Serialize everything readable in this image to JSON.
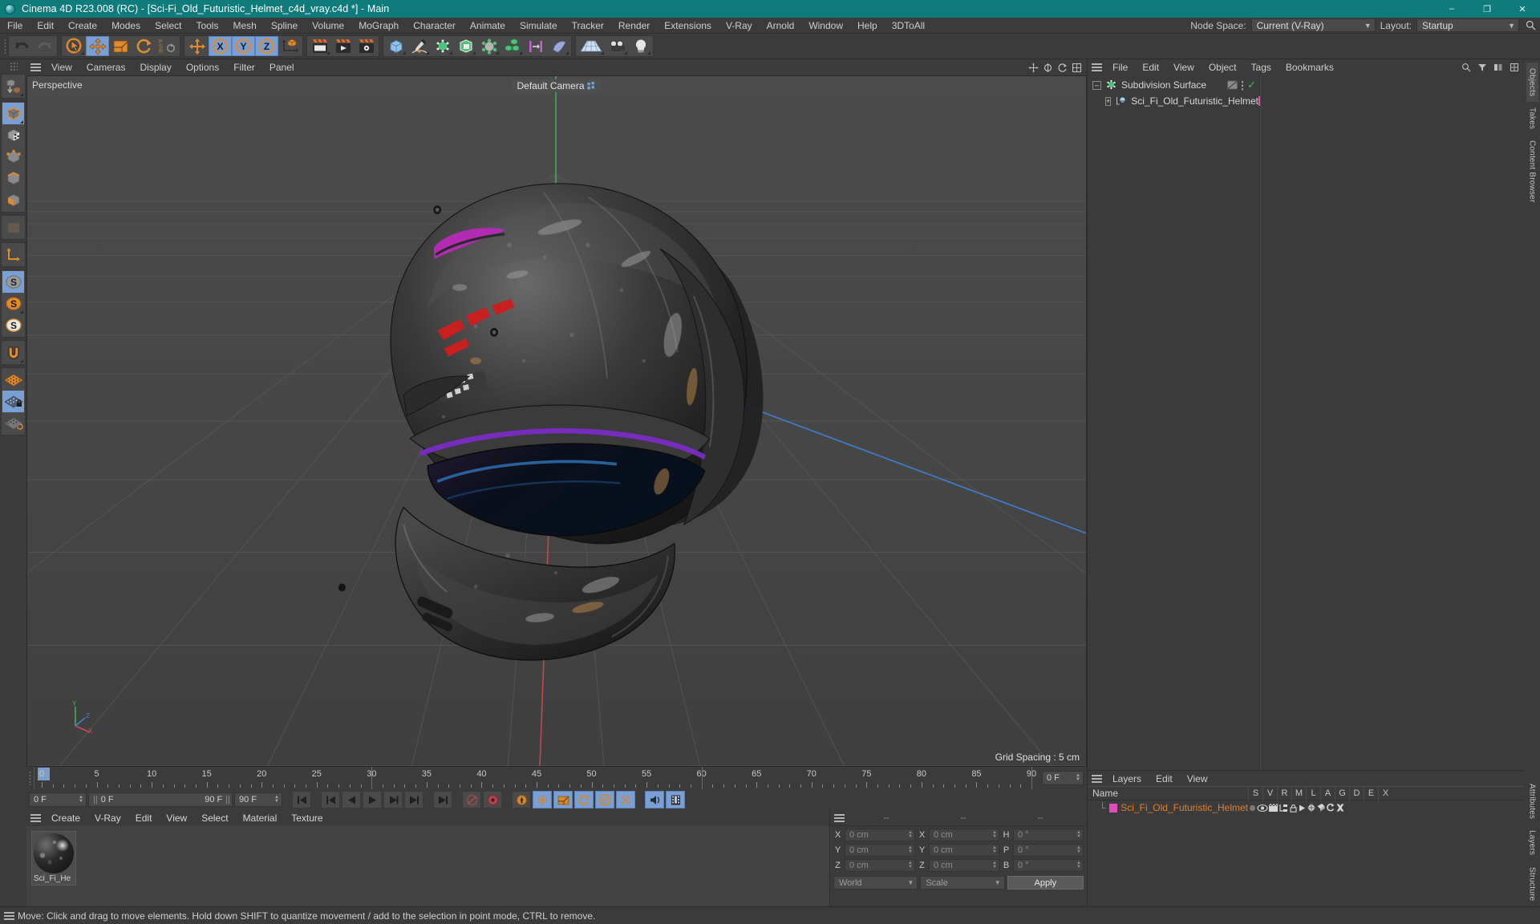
{
  "window": {
    "title": "Cinema 4D R23.008 (RC) - [Sci-Fi_Old_Futuristic_Helmet_c4d_vray.c4d *] - Main",
    "minimize": "–",
    "maximize": "❐",
    "close": "✕",
    "titlebar_color": "#0f7b7b"
  },
  "menubar": {
    "items": [
      "File",
      "Edit",
      "Create",
      "Modes",
      "Select",
      "Tools",
      "Mesh",
      "Spline",
      "Volume",
      "MoGraph",
      "Character",
      "Animate",
      "Simulate",
      "Tracker",
      "Render",
      "Extensions",
      "V-Ray",
      "Arnold",
      "Window",
      "Help",
      "3DToAll"
    ],
    "node_space_label": "Node Space:",
    "node_space_value": "Current (V-Ray)",
    "layout_label": "Layout:",
    "layout_value": "Startup",
    "search_icon": "search-icon"
  },
  "toolbar": {
    "groups": [
      {
        "name": "history",
        "buttons": [
          {
            "name": "undo",
            "icon": "undo-arrow-icon"
          },
          {
            "name": "redo",
            "icon": "redo-arrow-icon"
          }
        ]
      },
      {
        "name": "transform",
        "buttons": [
          {
            "name": "live-selection",
            "icon": "cursor-circle-icon",
            "sub": true
          },
          {
            "name": "move",
            "icon": "move-arrows-icon",
            "selected": true
          },
          {
            "name": "scale",
            "icon": "scale-box-icon"
          },
          {
            "name": "rotate",
            "icon": "rotate-arrows-icon"
          },
          {
            "name": "psr-reset",
            "icon": "psr-icon"
          }
        ]
      },
      {
        "name": "axis-lock",
        "buttons": [
          {
            "name": "move-global",
            "icon": "move-arrows-icon"
          },
          {
            "name": "lock-x",
            "icon": "x-axis-icon",
            "selected": true
          },
          {
            "name": "lock-y",
            "icon": "y-axis-icon",
            "selected": true
          },
          {
            "name": "lock-z",
            "icon": "z-axis-icon",
            "selected": true
          },
          {
            "name": "world-object-coord",
            "icon": "world-axis-icon"
          }
        ]
      },
      {
        "name": "render",
        "buttons": [
          {
            "name": "render-view",
            "icon": "render-view-icon",
            "sub": true
          },
          {
            "name": "render-to-picture-viewer",
            "icon": "render-picture-icon"
          },
          {
            "name": "render-settings",
            "icon": "render-settings-icon"
          }
        ]
      },
      {
        "name": "primitives",
        "buttons": [
          {
            "name": "cube-primitive",
            "icon": "cube-blue-icon",
            "sub": true
          },
          {
            "name": "pen-spline",
            "icon": "pen-spline-icon",
            "sub": true
          },
          {
            "name": "nurbs-generator",
            "icon": "subdivision-surface-icon",
            "sub": true
          },
          {
            "name": "array-modeling",
            "icon": "green-cube-open-icon",
            "sub": true
          },
          {
            "name": "deformer",
            "icon": "bend-deformer-icon",
            "sub": true
          },
          {
            "name": "mograph-cloner",
            "icon": "cloner-cubes-icon",
            "sub": true
          },
          {
            "name": "field",
            "icon": "field-icon"
          },
          {
            "name": "character-object",
            "icon": "blue-shell-icon",
            "sub": true
          }
        ]
      },
      {
        "name": "scene",
        "buttons": [
          {
            "name": "floor-environment",
            "icon": "floor-grid-icon",
            "sub": true
          },
          {
            "name": "camera",
            "icon": "camera-icon",
            "sub": true
          },
          {
            "name": "light",
            "icon": "light-bulb-icon",
            "sub": true
          }
        ]
      }
    ]
  },
  "left_toolbar": {
    "buttons": [
      {
        "name": "make-editable",
        "icon": "make-editable-icon",
        "sub": true
      },
      {
        "name": "model-mode",
        "icon": "model-cube-icon",
        "selected": true,
        "sub": true
      },
      {
        "name": "texture-mode",
        "icon": "texture-checker-icon"
      },
      {
        "name": "points-mode",
        "icon": "points-cube-icon"
      },
      {
        "name": "edges-mode",
        "icon": "edges-cube-icon"
      },
      {
        "name": "polygons-mode",
        "icon": "polygons-cube-icon"
      },
      {
        "name": "uv-mode",
        "icon": "uv-mode-icon"
      },
      {
        "name": "axis-modify",
        "icon": "axis-l-icon"
      },
      {
        "name": "enable-snap",
        "icon": "snap-s-gray-icon",
        "selected": true
      },
      {
        "name": "snap-settings-orange",
        "icon": "snap-s-orange-icon",
        "sub": true
      },
      {
        "name": "snap-settings-white",
        "icon": "snap-s-white-icon"
      },
      {
        "name": "magnet",
        "icon": "magnet-icon",
        "sub": true
      },
      {
        "name": "workplane",
        "icon": "workplane-grid-icon"
      },
      {
        "name": "lock-workplane",
        "icon": "workplane-lock-icon",
        "selected": true
      },
      {
        "name": "planar-workplane",
        "icon": "workplane-rotate-icon"
      }
    ]
  },
  "viewport": {
    "menu": [
      "View",
      "Cameras",
      "Display",
      "Options",
      "Filter",
      "Panel"
    ],
    "label": "Perspective",
    "camera_label": "Default Camera",
    "grid_spacing": "Grid Spacing : 5 cm",
    "axis_labels": {
      "x": "X",
      "y": "Y",
      "z": "Z"
    },
    "header_icons": [
      "pan-icon",
      "zoom-icon",
      "rotate-view-icon",
      "maximize-view-icon"
    ]
  },
  "timeline": {
    "start": 0,
    "end": 90,
    "major_ticks": [
      0,
      5,
      10,
      15,
      20,
      25,
      30,
      35,
      40,
      45,
      50,
      55,
      60,
      65,
      70,
      75,
      80,
      85,
      90
    ],
    "current_frame": "0 F",
    "frame_field_left": "0 F",
    "frame_field_preview_start": "0 F",
    "frame_field_preview_end": "90 F",
    "frame_field_end": "90 F",
    "playhead_frame": 0,
    "transport_buttons": [
      {
        "name": "go-to-start",
        "icon": "skip-start-icon"
      },
      {
        "name": "go-to-previous-key",
        "icon": "prev-key-icon"
      },
      {
        "name": "step-back",
        "icon": "step-back-icon"
      },
      {
        "name": "play",
        "icon": "play-icon"
      },
      {
        "name": "step-forward",
        "icon": "step-forward-icon"
      },
      {
        "name": "go-to-next-key",
        "icon": "next-key-icon"
      },
      {
        "name": "go-to-end",
        "icon": "skip-end-icon"
      },
      {
        "name": "record-active-objects",
        "icon": "record-ring-icon"
      },
      {
        "name": "autokeying",
        "icon": "autokey-icon"
      },
      {
        "name": "keyframe-selection",
        "icon": "key-selection-icon"
      },
      {
        "name": "position-key",
        "icon": "position-key-icon"
      },
      {
        "name": "scale-key",
        "icon": "scale-key-icon",
        "selected": true
      },
      {
        "name": "rotation-key",
        "icon": "rotation-key-icon",
        "selected": true
      },
      {
        "name": "parameter-key",
        "icon": "parameter-key-icon",
        "selected": true
      },
      {
        "name": "point-level-animation",
        "icon": "pla-dots-icon",
        "selected": true
      },
      {
        "name": "sound-toggle",
        "icon": "sound-icon",
        "selected": true
      },
      {
        "name": "timeline-window",
        "icon": "film-strip-icon",
        "selected": true
      }
    ]
  },
  "material_manager": {
    "menu": [
      "Create",
      "V-Ray",
      "Edit",
      "View",
      "Select",
      "Material",
      "Texture"
    ],
    "materials": [
      {
        "name": "Sci_Fi_He",
        "swatch": "dark-metal-sphere"
      }
    ]
  },
  "coordinates": {
    "headers": [
      "--",
      "--",
      "--"
    ],
    "rows": [
      {
        "left_axis": "X",
        "left_value": "0 cm",
        "mid_axis": "X",
        "mid_value": "0 cm",
        "right_axis": "H",
        "right_value": "0 °"
      },
      {
        "left_axis": "Y",
        "left_value": "0 cm",
        "mid_axis": "Y",
        "mid_value": "0 cm",
        "right_axis": "P",
        "right_value": "0 °"
      },
      {
        "left_axis": "Z",
        "left_value": "0 cm",
        "mid_axis": "Z",
        "mid_value": "0 cm",
        "right_axis": "B",
        "right_value": "0 °"
      }
    ],
    "coord_system": "World",
    "mode": "Scale",
    "apply_label": "Apply"
  },
  "object_manager": {
    "menu": [
      "File",
      "Edit",
      "View",
      "Object",
      "Tags",
      "Bookmarks"
    ],
    "items": [
      {
        "name": "Subdivision Surface",
        "level": 0,
        "icon": "subdivision-surface-icon",
        "enabled": true,
        "check": "✓"
      },
      {
        "name": "Sci_Fi_Old_Futuristic_Helmet",
        "level": 1,
        "icon": "polygon-object-icon",
        "swatch": "#e34bbd"
      }
    ]
  },
  "layer_manager": {
    "menu": [
      "Layers",
      "Edit",
      "View"
    ],
    "columns": [
      "S",
      "V",
      "R",
      "M",
      "L",
      "A",
      "G",
      "D",
      "E",
      "X"
    ],
    "name_header": "Name",
    "rows": [
      {
        "name": "Sci_Fi_Old_Futuristic_Helmet",
        "color": "#e34bbd"
      }
    ]
  },
  "right_tabs": [
    "Objects",
    "Takes",
    "Content Browser",
    "Attributes",
    "Layers",
    "Structure"
  ],
  "statusbar": {
    "text": "Move: Click and drag to move elements. Hold down SHIFT to quantize movement / add to the selection in point mode, CTRL to remove."
  },
  "colors": {
    "accent_teal": "#0f7b7b",
    "orange": "#e08030",
    "selection_blue": "#7a9fd4",
    "layer_pink": "#e34bbd",
    "viewport_bg": "#464646"
  }
}
